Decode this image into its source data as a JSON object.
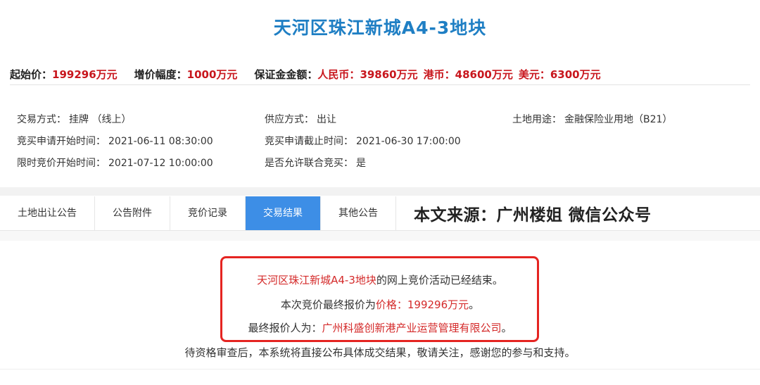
{
  "title": "天河区珠江新城A4-3地块",
  "price_bar": {
    "start_price_label": "起始价：",
    "start_price_value": "199296万元",
    "increment_label": "增价幅度：",
    "increment_value": "1000万元",
    "deposit_label": "保证金金额：",
    "rmb_label": "人民币：",
    "rmb_value": "39860万元",
    "hkd_label": "港币：",
    "hkd_value": "48600万元",
    "usd_label": "美元：",
    "usd_value": "6300万元"
  },
  "info": {
    "trade_mode_label": "交易方式：",
    "trade_mode_value": "挂牌 （线上）",
    "supply_mode_label": "供应方式：",
    "supply_mode_value": "出让",
    "land_use_label": "土地用途：",
    "land_use_value": "金融保险业用地（B21）",
    "apply_start_label": "竞买申请开始时间：",
    "apply_start_value": "2021-06-11 08:30:00",
    "apply_end_label": "竞买申请截止时间：",
    "apply_end_value": "2021-06-30 17:00:00",
    "bid_start_label": "限时竞价开始时间：",
    "bid_start_value": "2021-07-12 10:00:00",
    "joint_bid_label": "是否允许联合竞买：",
    "joint_bid_value": "是"
  },
  "tabs": [
    {
      "label": "土地出让公告",
      "active": false
    },
    {
      "label": "公告附件",
      "active": false
    },
    {
      "label": "竞价记录",
      "active": false
    },
    {
      "label": "交易结果",
      "active": true
    },
    {
      "label": "其他公告",
      "active": false
    }
  ],
  "source_note": "本文来源：广州楼姐 微信公众号",
  "result": {
    "line1_name": "天河区珠江新城A4-3地块",
    "line1_rest": "的网上竞价活动已经结束。",
    "line2_prefix": "本次竞价最终报价为",
    "line2_price": "价格：199296万元",
    "line2_suffix": "。",
    "line3_prefix": "最终报价人为：",
    "line3_winner": "广州科盛创新港产业运营管理有限公司",
    "line3_suffix": "。",
    "line4": "待资格审查后，本系统将直接公布具体成交结果，敬请关注，感谢您的参与和支持。"
  },
  "colors": {
    "title_blue": "#1f7fc4",
    "value_red": "#c8161d",
    "tab_active_blue": "#3d8ee6",
    "box_red": "#e52421"
  }
}
